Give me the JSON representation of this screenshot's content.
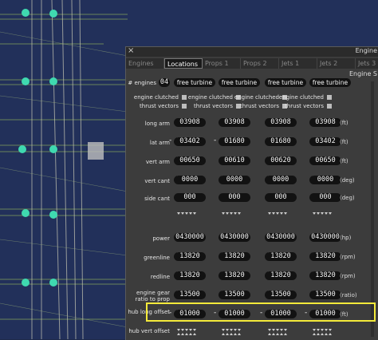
{
  "window": {
    "title": "Engine",
    "section_title": "Engine S",
    "close": "×"
  },
  "tabs": [
    "Engines",
    "Locations",
    "Props 1",
    "Props 2",
    "Jets 1",
    "Jets 2",
    "Jets 3"
  ],
  "active_tab": "Locations",
  "engines": {
    "count_label": "# engines",
    "count": "04",
    "types": [
      "free turbine",
      "free turbine",
      "free turbine",
      "free turbine"
    ]
  },
  "clutch_label": "engine clutched",
  "thrust_label": "thrust vectors",
  "rows": [
    {
      "label": "long arm",
      "values": [
        "03908",
        "03908",
        "03908",
        "03908"
      ],
      "signs": [
        "",
        "",
        "",
        ""
      ],
      "unit": "(ft)"
    },
    {
      "label": "lat arm",
      "values": [
        "03402",
        "01680",
        "01680",
        "03402"
      ],
      "signs": [
        "-",
        "-",
        "",
        ""
      ],
      "unit": "(ft)"
    },
    {
      "label": "vert arm",
      "values": [
        "00650",
        "00610",
        "00620",
        "00650"
      ],
      "signs": [
        "",
        "",
        "",
        ""
      ],
      "unit": "(ft)"
    },
    {
      "label": "vert cant",
      "values": [
        "0000",
        "0000",
        "0000",
        "0000"
      ],
      "signs": [
        "",
        "",
        "",
        ""
      ],
      "unit": "(deg)"
    },
    {
      "label": "side cant",
      "values": [
        "000",
        "000",
        "000",
        "000"
      ],
      "signs": [
        "",
        "",
        "",
        ""
      ],
      "unit": "(deg)"
    },
    {
      "label": "power",
      "values": [
        "0430000",
        "0430000",
        "0430000",
        "0430000"
      ],
      "signs": [
        "",
        "",
        "",
        ""
      ],
      "unit": "(hp)"
    },
    {
      "label": "greenline",
      "values": [
        "13820",
        "13820",
        "13820",
        "13820"
      ],
      "signs": [
        "",
        "",
        "",
        ""
      ],
      "unit": "(rpm)"
    },
    {
      "label": "redline",
      "values": [
        "13820",
        "13820",
        "13820",
        "13820"
      ],
      "signs": [
        "",
        "",
        "",
        ""
      ],
      "unit": "(rpm)"
    },
    {
      "label": "engine gear ratio to prop",
      "values": [
        "13500",
        "13500",
        "13500",
        "13500"
      ],
      "signs": [
        "",
        "",
        "",
        ""
      ],
      "unit": "(ratio)"
    },
    {
      "label": "hub long offset",
      "values": [
        "01000",
        "01000",
        "01000",
        "01000"
      ],
      "signs": [
        "-",
        "-",
        "-",
        "-"
      ],
      "unit": "(ft)"
    },
    {
      "label": "hub vert offset",
      "values": [
        "",
        "",
        "",
        ""
      ],
      "signs": [
        "",
        "",
        "",
        ""
      ],
      "unit": ""
    }
  ]
}
